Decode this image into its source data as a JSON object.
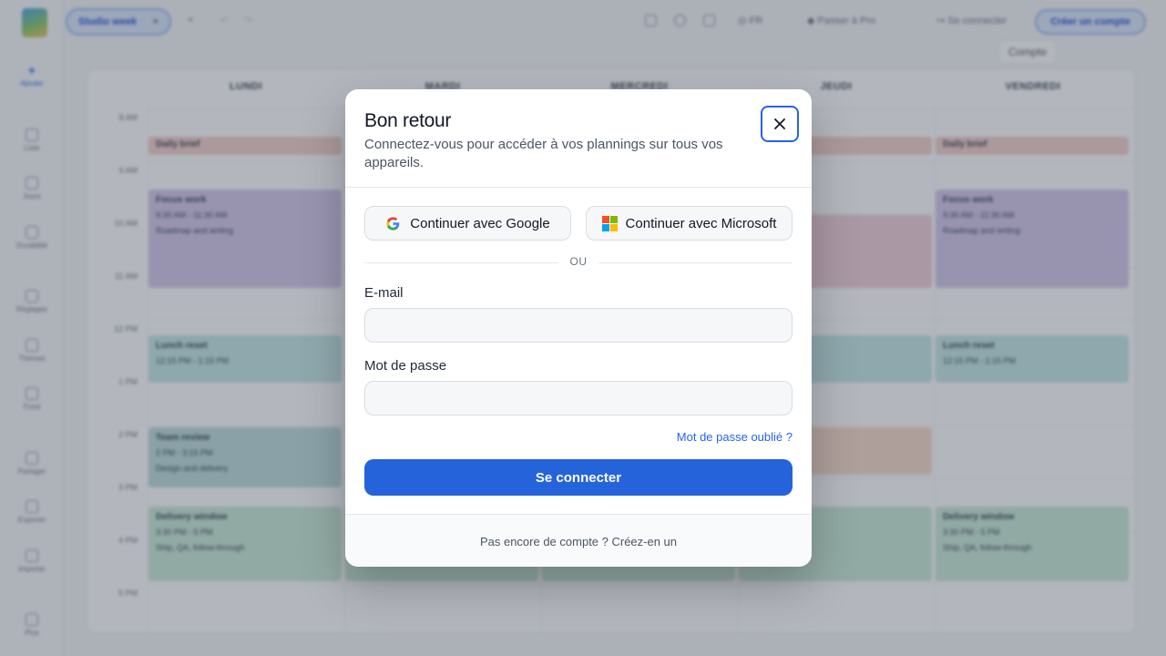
{
  "colors": {
    "accent": "#2563db",
    "overlay": "rgba(55,65,81,0.38)",
    "event_brief": "#f4cfc8",
    "event_focus": "#d4c7ea",
    "event_lunch": "#c3e7e6",
    "event_delivery": "#c9ead6"
  },
  "topbar": {
    "tab_label": "Studio week",
    "language": "FR",
    "upgrade": "Passer à Pro",
    "signin": "Se connecter",
    "create_account": "Créer un compte",
    "tooltip": "Compte"
  },
  "sidebar": {
    "add": "Ajouter",
    "items": [
      "Liste",
      "Jours",
      "Durabilité",
      "Réglages",
      "Thèmes",
      "Fond",
      "Partager",
      "Exporter",
      "Importer",
      "Plus"
    ]
  },
  "calendar": {
    "days": [
      "LUNDI",
      "MARDI",
      "MERCREDI",
      "JEUDI",
      "VENDREDI"
    ],
    "hours": [
      "8 AM",
      "9 AM",
      "10 AM",
      "11 AM",
      "12 PM",
      "1 PM",
      "2 PM",
      "3 PM",
      "4 PM",
      "5 PM"
    ],
    "events": {
      "daily_brief": "Daily brief",
      "focus_title": "Focus work",
      "focus_time": "9:30 AM - 11:30 AM",
      "focus_desc": "Roadmap and writing",
      "lunch_title": "Lunch reset",
      "lunch_time": "12:15 PM - 1:15 PM",
      "team_title": "Team review",
      "team_time": "2 PM - 3:15 PM",
      "team_desc": "Design and delivery",
      "delivery_title": "Delivery window",
      "delivery_time": "3:30 PM - 5 PM",
      "delivery_desc": "Ship, QA, follow-through"
    }
  },
  "modal": {
    "title": "Bon retour",
    "subtitle": "Connectez-vous pour accéder à vos plannings sur tous vos appareils.",
    "google_label": "Continuer avec Google",
    "microsoft_label": "Continuer avec Microsoft",
    "or_label": "OU",
    "email_label": "E-mail",
    "email_value": "",
    "password_label": "Mot de passe",
    "password_value": "",
    "forgot_label": "Mot de passe oublié ?",
    "submit_label": "Se connecter",
    "footer_label": "Pas encore de compte ? Créez-en un"
  }
}
